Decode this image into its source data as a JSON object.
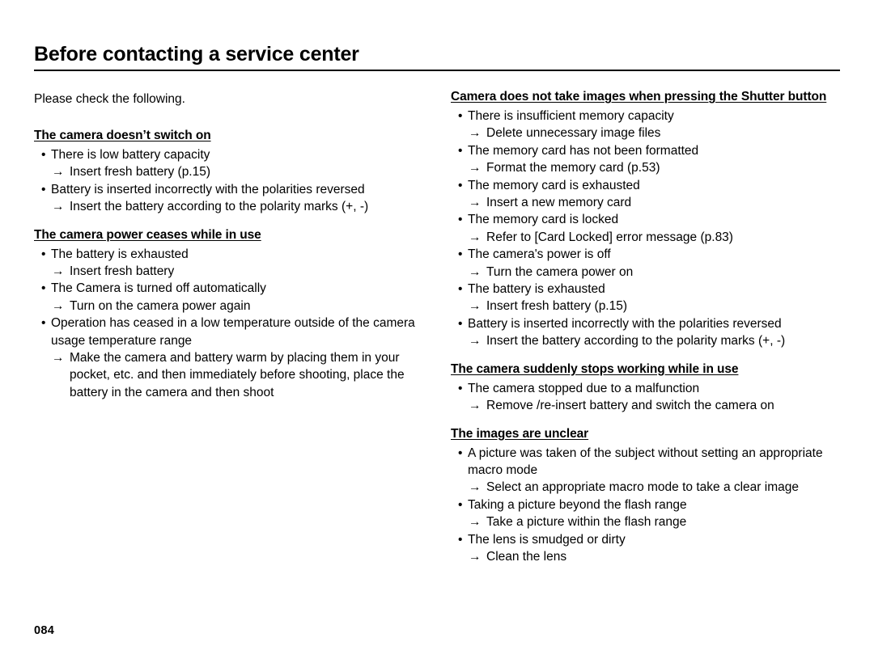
{
  "document": {
    "title": "Before contacting a service center",
    "intro": "Please check the following.",
    "page_number": "084",
    "bullet_glyph": "•",
    "arrow_glyph": "→"
  },
  "left_column": {
    "sections": [
      {
        "heading": "The camera doesn’t switch on",
        "items": [
          {
            "bullet": "There is low battery capacity",
            "arrow": "Insert fresh battery (p.15)"
          },
          {
            "bullet": "Battery is inserted incorrectly with the polarities reversed",
            "arrow": "Insert the battery according to the polarity marks (+, -)"
          }
        ]
      },
      {
        "heading": "The camera power ceases while in use",
        "items": [
          {
            "bullet": "The battery is exhausted",
            "arrow": "Insert fresh battery"
          },
          {
            "bullet": "The Camera is turned off automatically",
            "arrow": "Turn on the camera power again"
          },
          {
            "bullet": "Operation has ceased in a low temperature outside of the camera usage temperature range",
            "arrow": "Make the camera and battery warm by placing them in your pocket, etc. and then immediately before shooting, place the battery in the camera and then shoot"
          }
        ]
      }
    ]
  },
  "right_column": {
    "sections": [
      {
        "heading": "Camera does not take images when pressing the Shutter button",
        "items": [
          {
            "bullet": "There is insufficient memory capacity",
            "arrow": "Delete unnecessary image files"
          },
          {
            "bullet": "The memory card has not been formatted",
            "arrow": "Format the memory card (p.53)"
          },
          {
            "bullet": "The memory card is exhausted",
            "arrow": "Insert a new memory card"
          },
          {
            "bullet": "The memory card is locked",
            "arrow": "Refer to [Card Locked] error message (p.83)"
          },
          {
            "bullet": "The camera's power is off",
            "arrow": "Turn the camera power on"
          },
          {
            "bullet": "The battery is exhausted",
            "arrow": "Insert fresh battery (p.15)"
          },
          {
            "bullet": "Battery is inserted incorrectly with the polarities reversed",
            "arrow": "Insert the battery according to the polarity marks (+, -)"
          }
        ]
      },
      {
        "heading": "The camera suddenly stops working while in use",
        "items": [
          {
            "bullet": "The camera stopped due to a malfunction",
            "arrow": "Remove /re-insert battery and switch the camera on"
          }
        ]
      },
      {
        "heading": "The images are unclear",
        "items": [
          {
            "bullet": "A picture was taken of the subject without setting an appropriate macro mode",
            "arrow": "Select an appropriate macro mode to take a clear image"
          },
          {
            "bullet": "Taking a picture beyond the flash range",
            "arrow": "Take a picture within the flash range"
          },
          {
            "bullet": "The lens is smudged or dirty",
            "arrow": "Clean the lens"
          }
        ]
      }
    ]
  }
}
